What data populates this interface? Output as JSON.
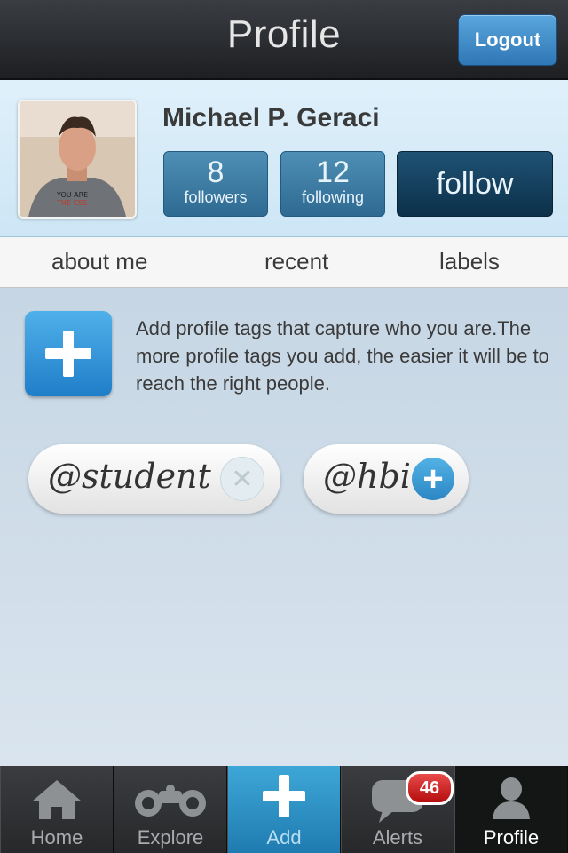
{
  "header": {
    "title": "Profile",
    "logout_label": "Logout"
  },
  "profile": {
    "name": "Michael P. Geraci",
    "followers": {
      "count": "8",
      "label": "followers"
    },
    "following": {
      "count": "12",
      "label": "following"
    },
    "follow_label": "follow"
  },
  "tabs": [
    {
      "label": "about me"
    },
    {
      "label": "recent"
    },
    {
      "label": "labels"
    }
  ],
  "content": {
    "hint": "Add profile tags that capture who you are.The more profile tags you add, the easier it will be to reach the right people.",
    "tags": [
      {
        "text": "@student",
        "action": "remove"
      },
      {
        "text": "@hbic",
        "action": "add"
      }
    ]
  },
  "tabbar": {
    "items": [
      {
        "label": "Home",
        "icon": "home-icon"
      },
      {
        "label": "Explore",
        "icon": "binoculars-icon"
      },
      {
        "label": "Add",
        "icon": "plus-icon",
        "active": true
      },
      {
        "label": "Alerts",
        "icon": "speech-bubble-icon",
        "badge": "46"
      },
      {
        "label": "Profile",
        "icon": "person-icon",
        "selected": true
      }
    ]
  },
  "colors": {
    "accent": "#2f77b6",
    "badge": "#d32222",
    "header": "#2a2c30"
  }
}
